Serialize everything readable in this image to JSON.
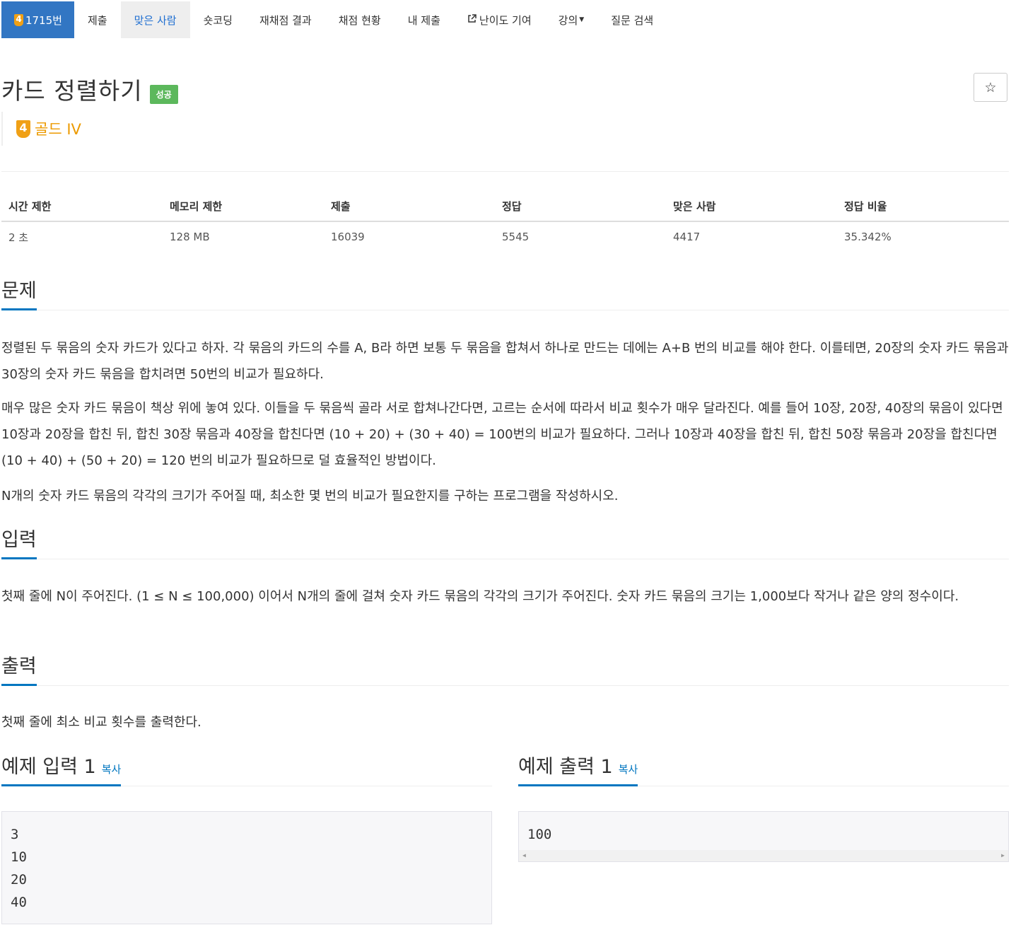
{
  "nav": {
    "problem_tier": "4",
    "problem_id": "1715번",
    "items": [
      "제출",
      "맞은 사람",
      "숏코딩",
      "재채점 결과",
      "채점 현황",
      "내 제출",
      "난이도 기여",
      "강의",
      "질문 검색"
    ]
  },
  "problem": {
    "title": "카드 정렬하기",
    "status_badge": "성공",
    "star": "☆",
    "tier_number": "4",
    "tier_name": "골드 IV"
  },
  "info_table": {
    "headers": [
      "시간 제한",
      "메모리 제한",
      "제출",
      "정답",
      "맞은 사람",
      "정답 비율"
    ],
    "values": [
      "2 초",
      "128 MB",
      "16039",
      "5545",
      "4417",
      "35.342%"
    ]
  },
  "sections": {
    "description_title": "문제",
    "description": [
      "정렬된 두 묶음의 숫자 카드가 있다고 하자. 각 묶음의 카드의 수를 A, B라 하면 보통 두 묶음을 합쳐서 하나로 만드는 데에는 A+B 번의 비교를 해야 한다. 이를테면, 20장의 숫자 카드 묶음과 30장의 숫자 카드 묶음을 합치려면 50번의 비교가 필요하다.",
      "매우 많은 숫자 카드 묶음이 책상 위에 놓여 있다. 이들을 두 묶음씩 골라 서로 합쳐나간다면, 고르는 순서에 따라서 비교 횟수가 매우 달라진다. 예를 들어 10장, 20장, 40장의 묶음이 있다면 10장과 20장을 합친 뒤, 합친 30장 묶음과 40장을 합친다면 (10 + 20) + (30 + 40) = 100번의 비교가 필요하다. 그러나 10장과 40장을 합친 뒤, 합친 50장 묶음과 20장을 합친다면 (10 + 40) + (50 + 20) = 120 번의 비교가 필요하므로 덜 효율적인 방법이다.",
      "N개의 숫자 카드 묶음의 각각의 크기가 주어질 때, 최소한 몇 번의 비교가 필요한지를 구하는 프로그램을 작성하시오."
    ],
    "input_title": "입력",
    "input": "첫째 줄에 N이 주어진다. (1 ≤ N ≤ 100,000) 이어서 N개의 줄에 걸쳐 숫자 카드 묶음의 각각의 크기가 주어진다. 숫자 카드 묶음의 크기는 1,000보다 작거나 같은 양의 정수이다.",
    "output_title": "출력",
    "output": "첫째 줄에 최소 비교 횟수를 출력한다."
  },
  "samples": {
    "input_title": "예제 입력 1",
    "output_title": "예제 출력 1",
    "copy_label": "복사",
    "input": "3\n10\n20\n40",
    "output": "100"
  }
}
